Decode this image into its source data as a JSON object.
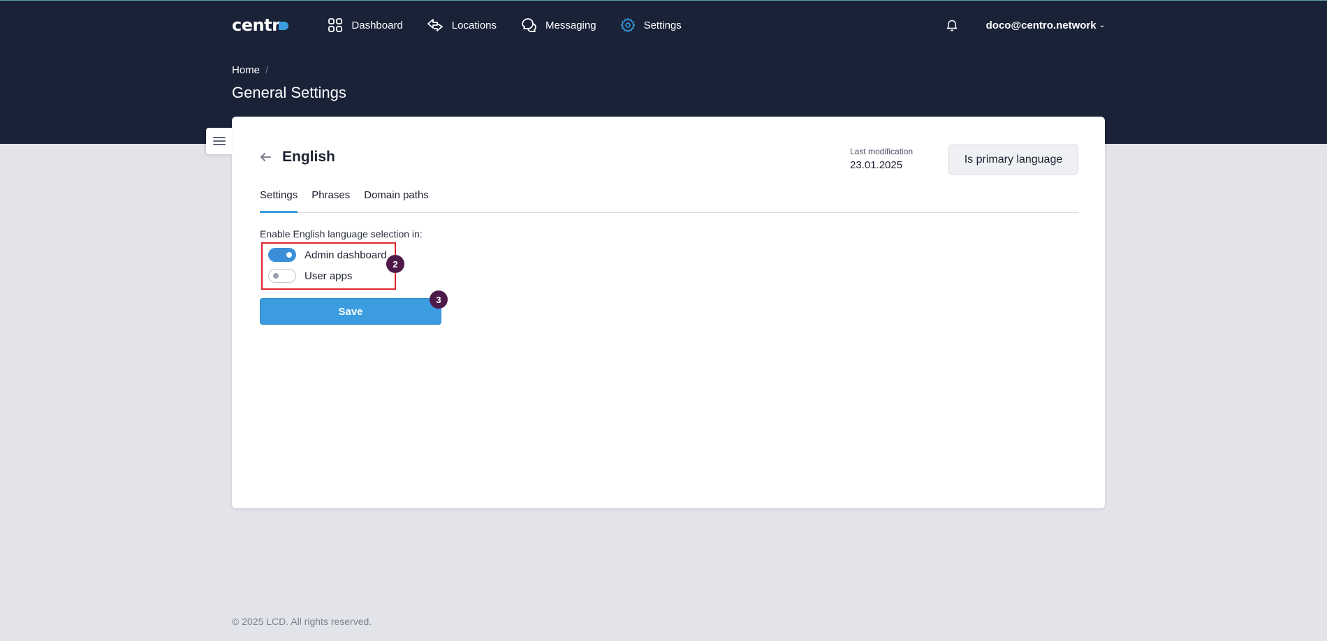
{
  "app": {
    "logo_text": "centr",
    "accent": "#3b9de0",
    "header_bg": "#1a2238"
  },
  "nav": {
    "items": [
      {
        "label": "Dashboard",
        "icon": "grid-icon",
        "active": false
      },
      {
        "label": "Locations",
        "icon": "arrows-swap-icon",
        "active": false
      },
      {
        "label": "Messaging",
        "icon": "chat-bubbles-icon",
        "active": false
      },
      {
        "label": "Settings",
        "icon": "gear-icon",
        "active": true
      }
    ],
    "user_email": "doco@centro.network"
  },
  "breadcrumb": {
    "home": "Home",
    "separator": "/"
  },
  "page": {
    "title": "General Settings"
  },
  "card": {
    "language_title": "English",
    "last_mod_label": "Last modification",
    "last_mod_date": "23.01.2025",
    "primary_button": "Is primary language",
    "tabs": [
      {
        "label": "Settings",
        "active": true
      },
      {
        "label": "Phrases",
        "active": false
      },
      {
        "label": "Domain paths",
        "active": false
      }
    ],
    "enable_label": "Enable English language selection in:",
    "toggles": [
      {
        "label": "Admin dashboard",
        "on": true
      },
      {
        "label": "User apps",
        "on": false
      }
    ],
    "save_label": "Save"
  },
  "annotations": {
    "step_toggles": "2",
    "step_save": "3",
    "highlight_color": "#e0252f",
    "badge_color": "#4e1a4a"
  },
  "footer": {
    "text": "© 2025 LCD. All rights reserved."
  }
}
